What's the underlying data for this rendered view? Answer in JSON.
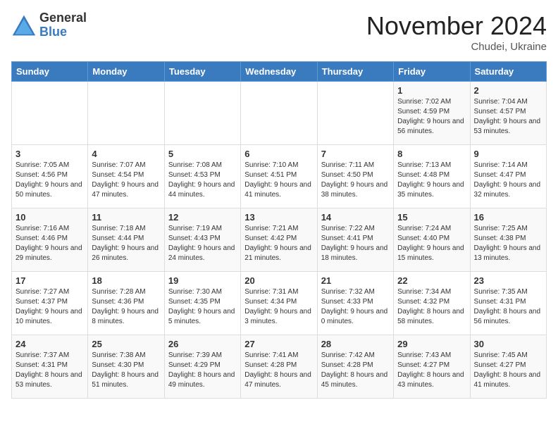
{
  "logo": {
    "general": "General",
    "blue": "Blue"
  },
  "title": {
    "month": "November 2024",
    "location": "Chudei, Ukraine"
  },
  "weekdays": [
    "Sunday",
    "Monday",
    "Tuesday",
    "Wednesday",
    "Thursday",
    "Friday",
    "Saturday"
  ],
  "weeks": [
    [
      {
        "day": "",
        "info": ""
      },
      {
        "day": "",
        "info": ""
      },
      {
        "day": "",
        "info": ""
      },
      {
        "day": "",
        "info": ""
      },
      {
        "day": "",
        "info": ""
      },
      {
        "day": "1",
        "info": "Sunrise: 7:02 AM\nSunset: 4:59 PM\nDaylight: 9 hours and 56 minutes."
      },
      {
        "day": "2",
        "info": "Sunrise: 7:04 AM\nSunset: 4:57 PM\nDaylight: 9 hours and 53 minutes."
      }
    ],
    [
      {
        "day": "3",
        "info": "Sunrise: 7:05 AM\nSunset: 4:56 PM\nDaylight: 9 hours and 50 minutes."
      },
      {
        "day": "4",
        "info": "Sunrise: 7:07 AM\nSunset: 4:54 PM\nDaylight: 9 hours and 47 minutes."
      },
      {
        "day": "5",
        "info": "Sunrise: 7:08 AM\nSunset: 4:53 PM\nDaylight: 9 hours and 44 minutes."
      },
      {
        "day": "6",
        "info": "Sunrise: 7:10 AM\nSunset: 4:51 PM\nDaylight: 9 hours and 41 minutes."
      },
      {
        "day": "7",
        "info": "Sunrise: 7:11 AM\nSunset: 4:50 PM\nDaylight: 9 hours and 38 minutes."
      },
      {
        "day": "8",
        "info": "Sunrise: 7:13 AM\nSunset: 4:48 PM\nDaylight: 9 hours and 35 minutes."
      },
      {
        "day": "9",
        "info": "Sunrise: 7:14 AM\nSunset: 4:47 PM\nDaylight: 9 hours and 32 minutes."
      }
    ],
    [
      {
        "day": "10",
        "info": "Sunrise: 7:16 AM\nSunset: 4:46 PM\nDaylight: 9 hours and 29 minutes."
      },
      {
        "day": "11",
        "info": "Sunrise: 7:18 AM\nSunset: 4:44 PM\nDaylight: 9 hours and 26 minutes."
      },
      {
        "day": "12",
        "info": "Sunrise: 7:19 AM\nSunset: 4:43 PM\nDaylight: 9 hours and 24 minutes."
      },
      {
        "day": "13",
        "info": "Sunrise: 7:21 AM\nSunset: 4:42 PM\nDaylight: 9 hours and 21 minutes."
      },
      {
        "day": "14",
        "info": "Sunrise: 7:22 AM\nSunset: 4:41 PM\nDaylight: 9 hours and 18 minutes."
      },
      {
        "day": "15",
        "info": "Sunrise: 7:24 AM\nSunset: 4:40 PM\nDaylight: 9 hours and 15 minutes."
      },
      {
        "day": "16",
        "info": "Sunrise: 7:25 AM\nSunset: 4:38 PM\nDaylight: 9 hours and 13 minutes."
      }
    ],
    [
      {
        "day": "17",
        "info": "Sunrise: 7:27 AM\nSunset: 4:37 PM\nDaylight: 9 hours and 10 minutes."
      },
      {
        "day": "18",
        "info": "Sunrise: 7:28 AM\nSunset: 4:36 PM\nDaylight: 9 hours and 8 minutes."
      },
      {
        "day": "19",
        "info": "Sunrise: 7:30 AM\nSunset: 4:35 PM\nDaylight: 9 hours and 5 minutes."
      },
      {
        "day": "20",
        "info": "Sunrise: 7:31 AM\nSunset: 4:34 PM\nDaylight: 9 hours and 3 minutes."
      },
      {
        "day": "21",
        "info": "Sunrise: 7:32 AM\nSunset: 4:33 PM\nDaylight: 9 hours and 0 minutes."
      },
      {
        "day": "22",
        "info": "Sunrise: 7:34 AM\nSunset: 4:32 PM\nDaylight: 8 hours and 58 minutes."
      },
      {
        "day": "23",
        "info": "Sunrise: 7:35 AM\nSunset: 4:31 PM\nDaylight: 8 hours and 56 minutes."
      }
    ],
    [
      {
        "day": "24",
        "info": "Sunrise: 7:37 AM\nSunset: 4:31 PM\nDaylight: 8 hours and 53 minutes."
      },
      {
        "day": "25",
        "info": "Sunrise: 7:38 AM\nSunset: 4:30 PM\nDaylight: 8 hours and 51 minutes."
      },
      {
        "day": "26",
        "info": "Sunrise: 7:39 AM\nSunset: 4:29 PM\nDaylight: 8 hours and 49 minutes."
      },
      {
        "day": "27",
        "info": "Sunrise: 7:41 AM\nSunset: 4:28 PM\nDaylight: 8 hours and 47 minutes."
      },
      {
        "day": "28",
        "info": "Sunrise: 7:42 AM\nSunset: 4:28 PM\nDaylight: 8 hours and 45 minutes."
      },
      {
        "day": "29",
        "info": "Sunrise: 7:43 AM\nSunset: 4:27 PM\nDaylight: 8 hours and 43 minutes."
      },
      {
        "day": "30",
        "info": "Sunrise: 7:45 AM\nSunset: 4:27 PM\nDaylight: 8 hours and 41 minutes."
      }
    ]
  ]
}
